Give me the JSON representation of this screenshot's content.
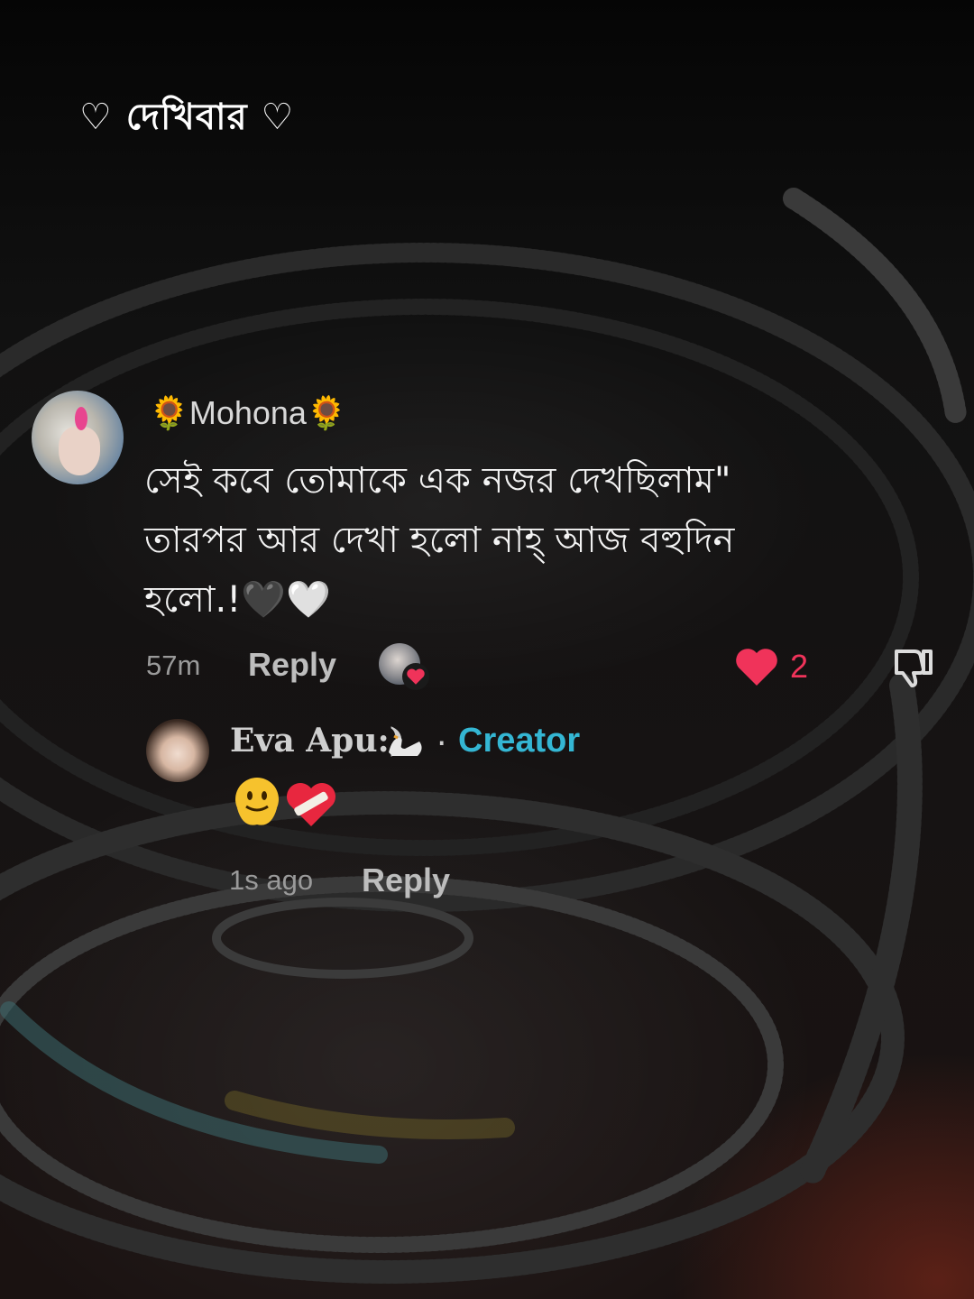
{
  "header": {
    "title": "♡ দেখিবার ♡"
  },
  "comment": {
    "username": "🌻Mohona🌻",
    "text": "সেই কবে তোমাকে এক নজর দেখছিলাম\" তারপর আর দেখা হলো নাহ্ আজ বহুদিন হলো.!🖤🤍",
    "time": "57m",
    "reply_label": "Reply",
    "like_count": "2",
    "liked": true
  },
  "reply": {
    "username": "Eva Apu:)",
    "creator_label": "Creator",
    "separator": "·",
    "text": "🫠❤️‍🩹",
    "time": "1s ago",
    "reply_label": "Reply"
  },
  "colors": {
    "like": "#f0335a",
    "creator": "#34b6d3"
  }
}
